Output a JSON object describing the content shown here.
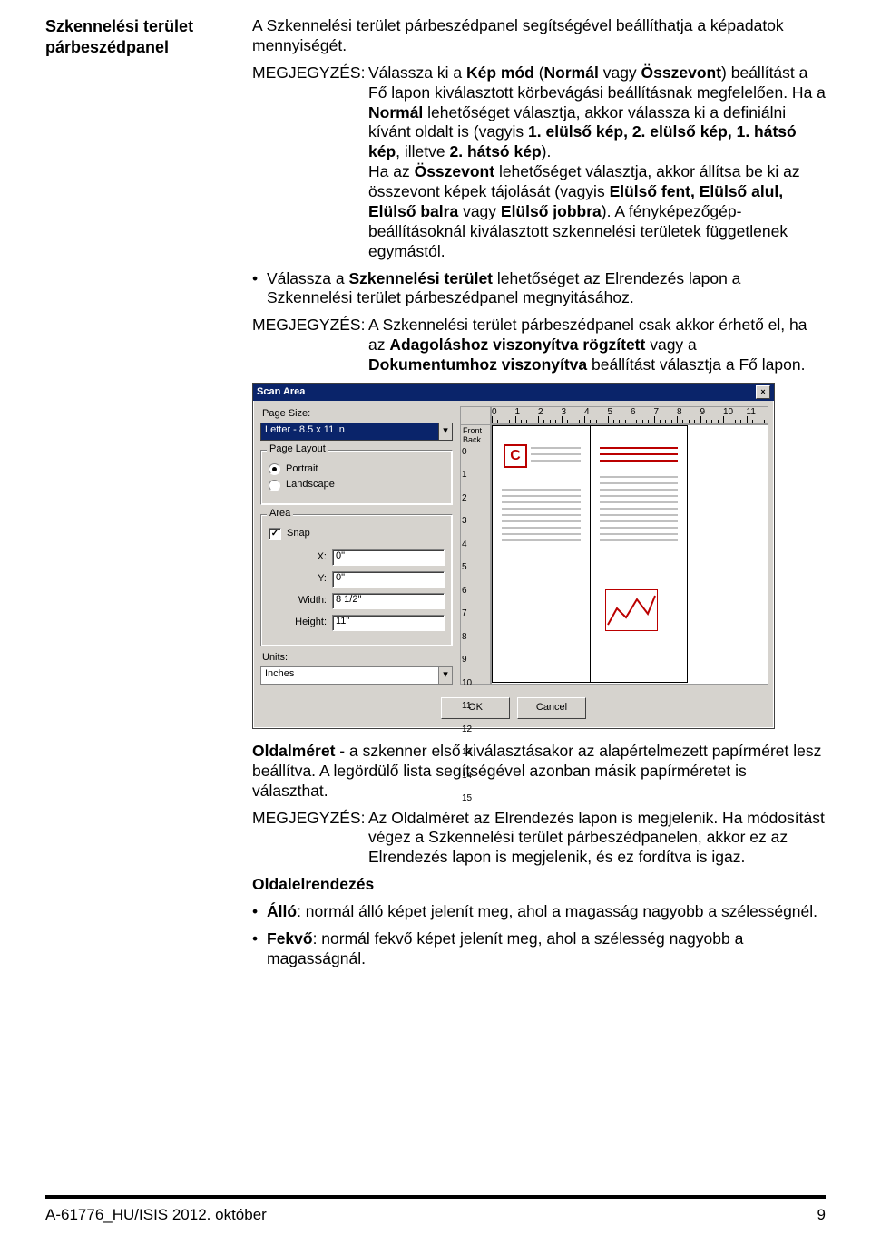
{
  "sidebar": {
    "heading": "Szkennelési terület párbeszédpanel"
  },
  "body": {
    "intro": "A Szkennelési terület párbeszédpanel segítségével beállíthatja a képadatok mennyiségét.",
    "note1_label": "MEGJEGYZÉS:",
    "note1_text_a": "Válassza ki a ",
    "note1_bold_a": "Kép mód",
    "note1_text_b": " (",
    "note1_bold_b": "Normál",
    "note1_text_c": " vagy ",
    "note1_bold_c": "Összevont",
    "note1_text_d": ") beállítást a Fő lapon kiválasztott körbevágási beállításnak megfelelően. Ha a ",
    "note1_bold_d": "Normál",
    "note1_text_e": " lehetőséget választja, akkor válassza ki a definiálni kívánt oldalt is (vagyis ",
    "note1_bold_e": "1. elülső kép, 2. elülső kép, 1. hátsó kép",
    "note1_text_f": ", illetve ",
    "note1_bold_f": "2. hátsó kép",
    "note1_text_g": ").",
    "note1_p2_a": "Ha az ",
    "note1_p2_bold_a": "Összevont",
    "note1_p2_b": " lehetőséget választja, akkor állítsa be ki az összevont képek tájolását (vagyis ",
    "note1_p2_bold_b": "Elülső fent, Elülső alul, Elülső balra",
    "note1_p2_c": " vagy ",
    "note1_p2_bold_c": "Elülső jobbra",
    "note1_p2_d": "). A fényképezőgép-beállításoknál kiválasztott szkennelési területek függetlenek egymástól.",
    "bullet1_a": "Válassza a ",
    "bullet1_bold": "Szkennelési terület",
    "bullet1_b": " lehetőséget az Elrendezés lapon a Szkennelési terület párbeszédpanel megnyitásához.",
    "note2_label": "MEGJEGYZÉS:",
    "note2_a": "A Szkennelési terület párbeszédpanel csak akkor érhető el, ha az ",
    "note2_bold_a": "Adagoláshoz viszonyítva rögzített",
    "note2_b": " vagy a ",
    "note2_bold_b": "Dokumentumhoz viszonyítva",
    "note2_c": " beállítást választja a Fő lapon.",
    "oldalmeret_bold": "Oldalméret",
    "oldalmeret_text": " - a szkenner első kiválasztásakor az alapértelmezett papírméret lesz beállítva. A legördülő lista segítségével azonban másik papírméretet is választhat.",
    "note3_label": "MEGJEGYZÉS:",
    "note3_text": "Az Oldalméret az Elrendezés lapon is megjelenik. Ha módosítást végez a Szkennelési terület párbeszédpanelen, akkor ez az Elrendezés lapon is megjelenik, és ez fordítva is igaz.",
    "oldalelrendezes": "Oldalelrendezés",
    "bullet_allo_bold": "Álló",
    "bullet_allo_text": ": normál álló képet jelenít meg, ahol a magasság nagyobb a szélességnél.",
    "bullet_fekvo_bold": "Fekvő",
    "bullet_fekvo_text": ": normál fekvő képet jelenít meg, ahol a szélesség nagyobb a magasságnál."
  },
  "dialog": {
    "title": "Scan Area",
    "close_x": "×",
    "page_size_label": "Page Size:",
    "page_size_value": "Letter - 8.5 x 11 in",
    "page_layout_legend": "Page Layout",
    "portrait": "Portrait",
    "landscape": "Landscape",
    "area_legend": "Area",
    "snap": "Snap",
    "x_label": "X:",
    "x_val": "0\"",
    "y_label": "Y:",
    "y_val": "0\"",
    "w_label": "Width:",
    "w_val": "8 1/2\"",
    "h_label": "Height:",
    "h_val": "11\"",
    "units_label": "Units:",
    "units_value": "Inches",
    "ok": "OK",
    "cancel": "Cancel",
    "ruler_front": "Front",
    "ruler_back": "Back",
    "doc_letter": "C",
    "hticks": [
      "0",
      "1",
      "2",
      "3",
      "4",
      "5",
      "6",
      "7",
      "8",
      "9",
      "10",
      "11"
    ],
    "vticks": [
      "0",
      "1",
      "2",
      "3",
      "4",
      "5",
      "6",
      "7",
      "8",
      "9",
      "10",
      "11",
      "12",
      "13",
      "14",
      "15"
    ]
  },
  "footer": {
    "left": "A-61776_HU/ISIS 2012. október",
    "right": "9"
  }
}
